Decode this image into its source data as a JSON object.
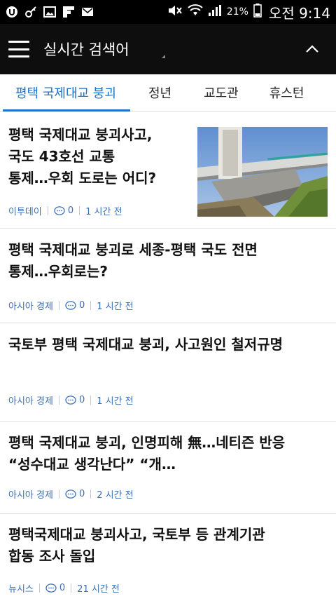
{
  "status_bar": {
    "battery_percent": "21%",
    "time": "오전 9:14"
  },
  "app_bar": {
    "title": "실시간 검색어"
  },
  "tabs": [
    {
      "label": "평택 국제대교 붕괴",
      "active": true
    },
    {
      "label": "정년",
      "active": false
    },
    {
      "label": "교도관",
      "active": false
    },
    {
      "label": "휴스턴",
      "active": false
    }
  ],
  "articles": [
    {
      "title_lines": [
        "평택 국제대교 붕괴사고,",
        "국도 43호선 교통",
        "통제…우회 도로는 어디?"
      ],
      "source": "이투데이",
      "comments": "0",
      "time": "1 시간 전",
      "has_thumbnail": true
    },
    {
      "title_lines": [
        "평택 국제대교 붕괴로 세종-평택 국도 전면",
        "통제…우회로는?"
      ],
      "source": "아시아 경제",
      "comments": "0",
      "time": "1 시간 전"
    },
    {
      "title_lines": [
        "국토부  평택 국제대교 붕괴, 사고원인 철저규명"
      ],
      "source": "아시아 경제",
      "comments": "0",
      "time": "1 시간 전"
    },
    {
      "title_lines": [
        "평택 국제대교 붕괴, 인명피해 無…네티즌 반응",
        "“성수대교 생각난다” “개…"
      ],
      "source": "아시아 경제",
      "comments": "0",
      "time": "2 시간 전"
    },
    {
      "title_lines": [
        "평택국제대교 붕괴사고, 국토부 등 관계기관",
        "합동 조사 돌입"
      ],
      "source": "뉴시스",
      "comments": "0",
      "time": "21 시간 전"
    }
  ],
  "colors": {
    "accent": "#1a73c9",
    "meta_text": "#3a6fb8",
    "app_bar": "#0e0e0e"
  }
}
